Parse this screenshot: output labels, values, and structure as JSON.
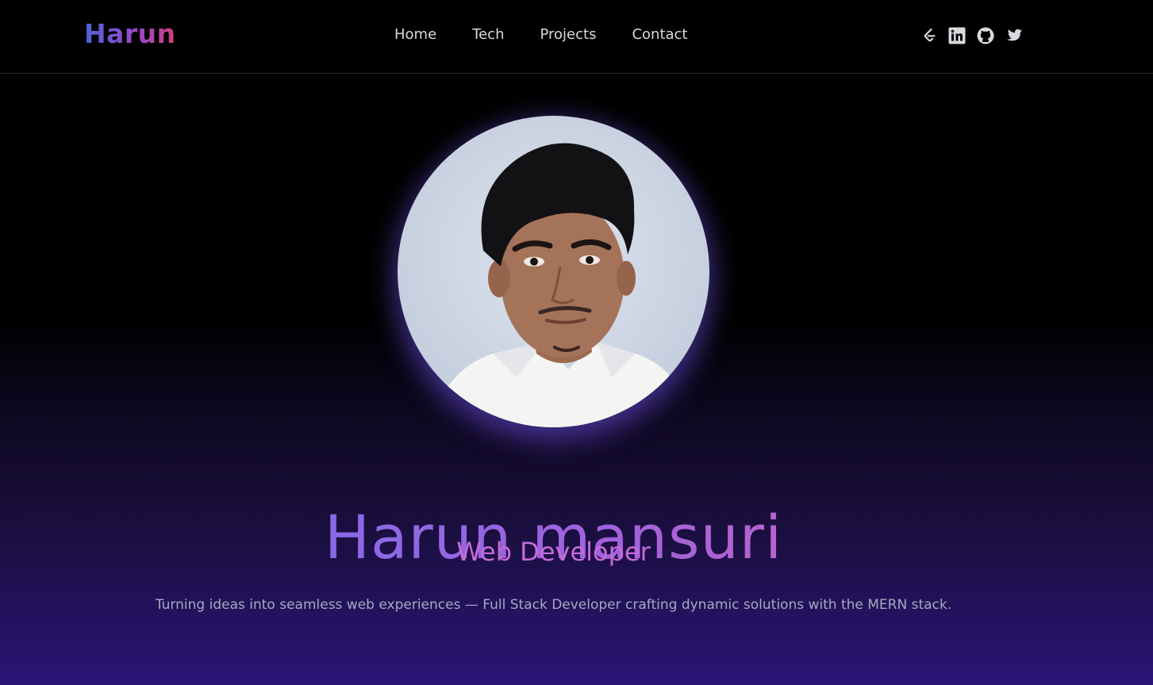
{
  "nav": {
    "logo": "Harun",
    "links": [
      "Home",
      "Tech",
      "Projects",
      "Contact"
    ],
    "social_icons": [
      "leetcode-icon",
      "linkedin-icon",
      "github-icon",
      "twitter-icon"
    ]
  },
  "hero": {
    "name": "Harun mansuri",
    "role": "Web Developer",
    "tagline": "Turning ideas into seamless web experiences — Full Stack Developer crafting dynamic solutions with the MERN stack."
  },
  "colors": {
    "background": "#000000",
    "accent_purple": "#2b1577",
    "name_gradient_start": "#6f72f2",
    "name_gradient_end": "#e066b4",
    "role_color": "#c66ad8",
    "nav_text": "#d8d8df"
  }
}
